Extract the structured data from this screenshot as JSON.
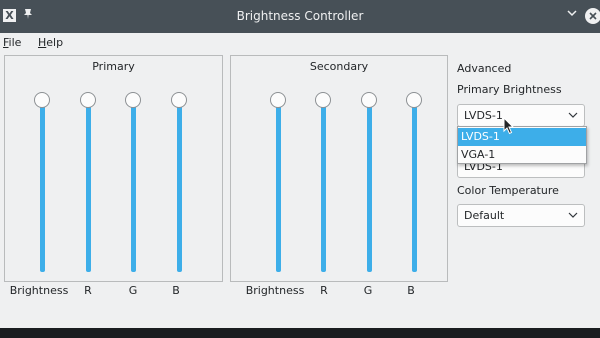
{
  "window": {
    "title": "Brightness Controller",
    "app_icon": "X",
    "pin_icon": "pin-icon",
    "minimize_icon": "chevron-down-icon",
    "close_icon": "close-icon"
  },
  "menu": {
    "file_label": "File",
    "file_mnemonic": "F",
    "file_rest": "ile",
    "help_label": "Help",
    "help_mnemonic": "H",
    "help_rest": "elp"
  },
  "primary": {
    "title": "Primary",
    "sliders": [
      {
        "label": "Brightness",
        "level": 1.0
      },
      {
        "label": "R",
        "level": 1.0
      },
      {
        "label": "G",
        "level": 1.0
      },
      {
        "label": "B",
        "level": 1.0
      }
    ]
  },
  "secondary": {
    "title": "Secondary",
    "sliders": [
      {
        "label": "Brightness",
        "level": 1.0
      },
      {
        "label": "R",
        "level": 1.0
      },
      {
        "label": "G",
        "level": 1.0
      },
      {
        "label": "B",
        "level": 1.0
      }
    ]
  },
  "advanced": {
    "title": "Advanced",
    "primary_brightness_label": "Primary Brightness",
    "primary_brightness_value": "LVDS-1",
    "dropdown_options": [
      "LVDS-1",
      "VGA-1"
    ],
    "dropdown_selected_index": 0,
    "hidden_combo_value": "LVDS-1",
    "color_temperature_label": "Color Temperature",
    "color_temperature_value": "Default"
  },
  "colors": {
    "accent": "#3daee9",
    "titlebar": "#475057",
    "window_bg": "#eff0f1"
  }
}
